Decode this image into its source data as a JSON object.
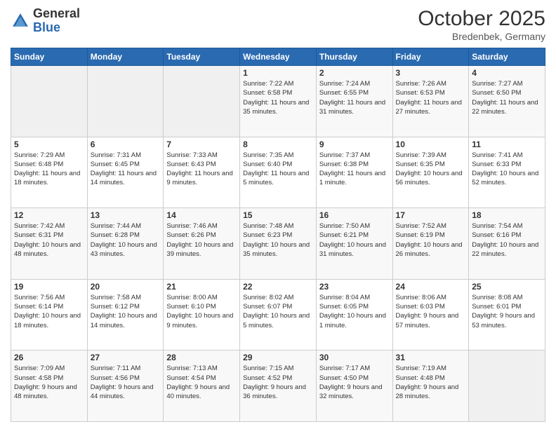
{
  "logo": {
    "general": "General",
    "blue": "Blue"
  },
  "header": {
    "month": "October 2025",
    "location": "Bredenbek, Germany"
  },
  "days_of_week": [
    "Sunday",
    "Monday",
    "Tuesday",
    "Wednesday",
    "Thursday",
    "Friday",
    "Saturday"
  ],
  "weeks": [
    [
      {
        "num": "",
        "empty": true
      },
      {
        "num": "",
        "empty": true
      },
      {
        "num": "",
        "empty": true
      },
      {
        "num": "1",
        "sunrise": "7:22 AM",
        "sunset": "6:58 PM",
        "daylight": "11 hours and 35 minutes."
      },
      {
        "num": "2",
        "sunrise": "7:24 AM",
        "sunset": "6:55 PM",
        "daylight": "11 hours and 31 minutes."
      },
      {
        "num": "3",
        "sunrise": "7:26 AM",
        "sunset": "6:53 PM",
        "daylight": "11 hours and 27 minutes."
      },
      {
        "num": "4",
        "sunrise": "7:27 AM",
        "sunset": "6:50 PM",
        "daylight": "11 hours and 22 minutes."
      }
    ],
    [
      {
        "num": "5",
        "sunrise": "7:29 AM",
        "sunset": "6:48 PM",
        "daylight": "11 hours and 18 minutes."
      },
      {
        "num": "6",
        "sunrise": "7:31 AM",
        "sunset": "6:45 PM",
        "daylight": "11 hours and 14 minutes."
      },
      {
        "num": "7",
        "sunrise": "7:33 AM",
        "sunset": "6:43 PM",
        "daylight": "11 hours and 9 minutes."
      },
      {
        "num": "8",
        "sunrise": "7:35 AM",
        "sunset": "6:40 PM",
        "daylight": "11 hours and 5 minutes."
      },
      {
        "num": "9",
        "sunrise": "7:37 AM",
        "sunset": "6:38 PM",
        "daylight": "11 hours and 1 minute."
      },
      {
        "num": "10",
        "sunrise": "7:39 AM",
        "sunset": "6:35 PM",
        "daylight": "10 hours and 56 minutes."
      },
      {
        "num": "11",
        "sunrise": "7:41 AM",
        "sunset": "6:33 PM",
        "daylight": "10 hours and 52 minutes."
      }
    ],
    [
      {
        "num": "12",
        "sunrise": "7:42 AM",
        "sunset": "6:31 PM",
        "daylight": "10 hours and 48 minutes."
      },
      {
        "num": "13",
        "sunrise": "7:44 AM",
        "sunset": "6:28 PM",
        "daylight": "10 hours and 43 minutes."
      },
      {
        "num": "14",
        "sunrise": "7:46 AM",
        "sunset": "6:26 PM",
        "daylight": "10 hours and 39 minutes."
      },
      {
        "num": "15",
        "sunrise": "7:48 AM",
        "sunset": "6:23 PM",
        "daylight": "10 hours and 35 minutes."
      },
      {
        "num": "16",
        "sunrise": "7:50 AM",
        "sunset": "6:21 PM",
        "daylight": "10 hours and 31 minutes."
      },
      {
        "num": "17",
        "sunrise": "7:52 AM",
        "sunset": "6:19 PM",
        "daylight": "10 hours and 26 minutes."
      },
      {
        "num": "18",
        "sunrise": "7:54 AM",
        "sunset": "6:16 PM",
        "daylight": "10 hours and 22 minutes."
      }
    ],
    [
      {
        "num": "19",
        "sunrise": "7:56 AM",
        "sunset": "6:14 PM",
        "daylight": "10 hours and 18 minutes."
      },
      {
        "num": "20",
        "sunrise": "7:58 AM",
        "sunset": "6:12 PM",
        "daylight": "10 hours and 14 minutes."
      },
      {
        "num": "21",
        "sunrise": "8:00 AM",
        "sunset": "6:10 PM",
        "daylight": "10 hours and 9 minutes."
      },
      {
        "num": "22",
        "sunrise": "8:02 AM",
        "sunset": "6:07 PM",
        "daylight": "10 hours and 5 minutes."
      },
      {
        "num": "23",
        "sunrise": "8:04 AM",
        "sunset": "6:05 PM",
        "daylight": "10 hours and 1 minute."
      },
      {
        "num": "24",
        "sunrise": "8:06 AM",
        "sunset": "6:03 PM",
        "daylight": "9 hours and 57 minutes."
      },
      {
        "num": "25",
        "sunrise": "8:08 AM",
        "sunset": "6:01 PM",
        "daylight": "9 hours and 53 minutes."
      }
    ],
    [
      {
        "num": "26",
        "sunrise": "7:09 AM",
        "sunset": "4:58 PM",
        "daylight": "9 hours and 48 minutes."
      },
      {
        "num": "27",
        "sunrise": "7:11 AM",
        "sunset": "4:56 PM",
        "daylight": "9 hours and 44 minutes."
      },
      {
        "num": "28",
        "sunrise": "7:13 AM",
        "sunset": "4:54 PM",
        "daylight": "9 hours and 40 minutes."
      },
      {
        "num": "29",
        "sunrise": "7:15 AM",
        "sunset": "4:52 PM",
        "daylight": "9 hours and 36 minutes."
      },
      {
        "num": "30",
        "sunrise": "7:17 AM",
        "sunset": "4:50 PM",
        "daylight": "9 hours and 32 minutes."
      },
      {
        "num": "31",
        "sunrise": "7:19 AM",
        "sunset": "4:48 PM",
        "daylight": "9 hours and 28 minutes."
      },
      {
        "num": "",
        "empty": true
      }
    ]
  ]
}
